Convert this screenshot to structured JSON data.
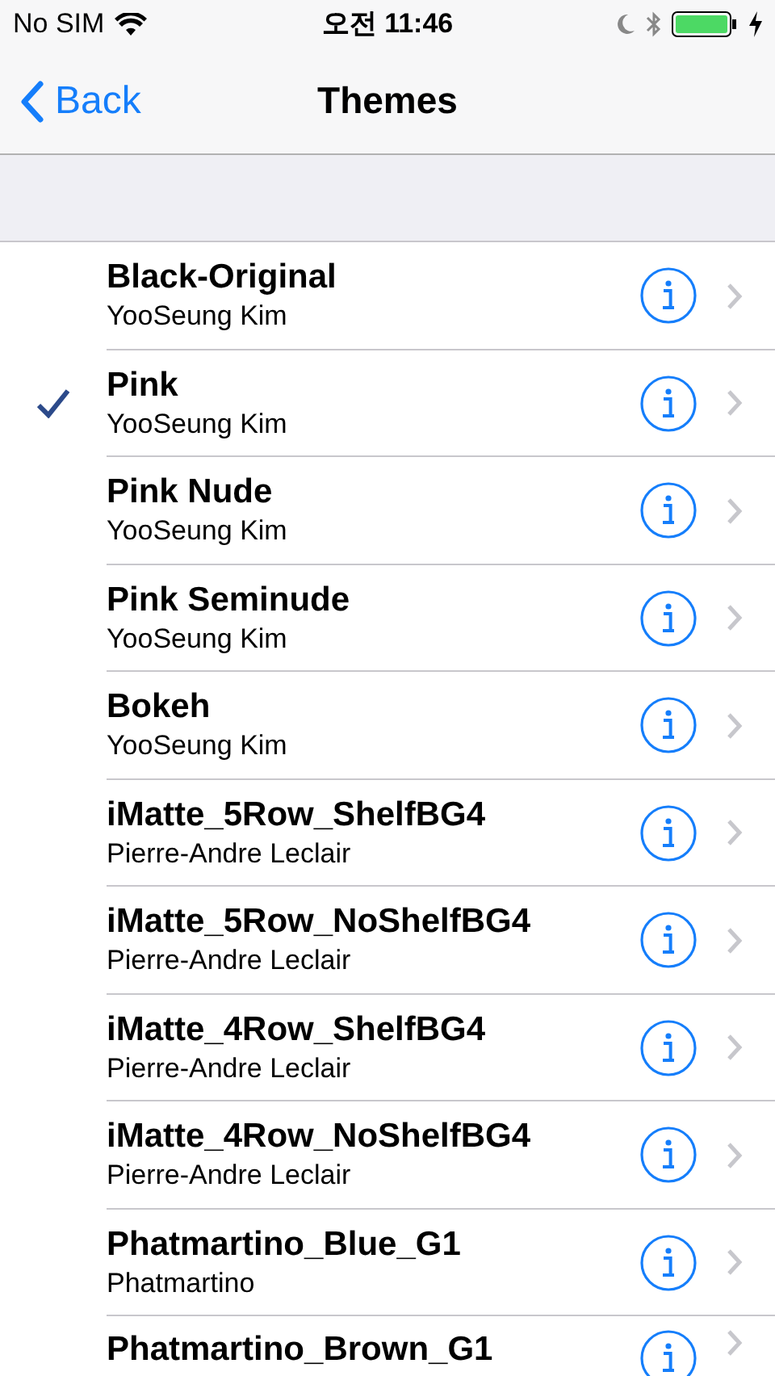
{
  "status_bar": {
    "carrier": "No SIM",
    "time": "오전 11:46"
  },
  "nav": {
    "back": "Back",
    "title": "Themes"
  },
  "themes": [
    {
      "name": "Black-Original",
      "author": "YooSeung Kim",
      "selected": false
    },
    {
      "name": "Pink",
      "author": "YooSeung Kim",
      "selected": true
    },
    {
      "name": "Pink Nude",
      "author": "YooSeung Kim",
      "selected": false
    },
    {
      "name": "Pink Seminude",
      "author": "YooSeung Kim",
      "selected": false
    },
    {
      "name": "Bokeh",
      "author": "YooSeung Kim",
      "selected": false
    },
    {
      "name": "iMatte_5Row_ShelfBG4",
      "author": "Pierre-Andre Leclair",
      "selected": false
    },
    {
      "name": "iMatte_5Row_NoShelfBG4",
      "author": "Pierre-Andre Leclair",
      "selected": false
    },
    {
      "name": "iMatte_4Row_ShelfBG4",
      "author": "Pierre-Andre Leclair",
      "selected": false
    },
    {
      "name": "iMatte_4Row_NoShelfBG4",
      "author": "Pierre-Andre Leclair",
      "selected": false
    },
    {
      "name": "Phatmartino_Blue_G1",
      "author": "Phatmartino",
      "selected": false
    },
    {
      "name": "Phatmartino_Brown_G1",
      "selected": false
    }
  ]
}
